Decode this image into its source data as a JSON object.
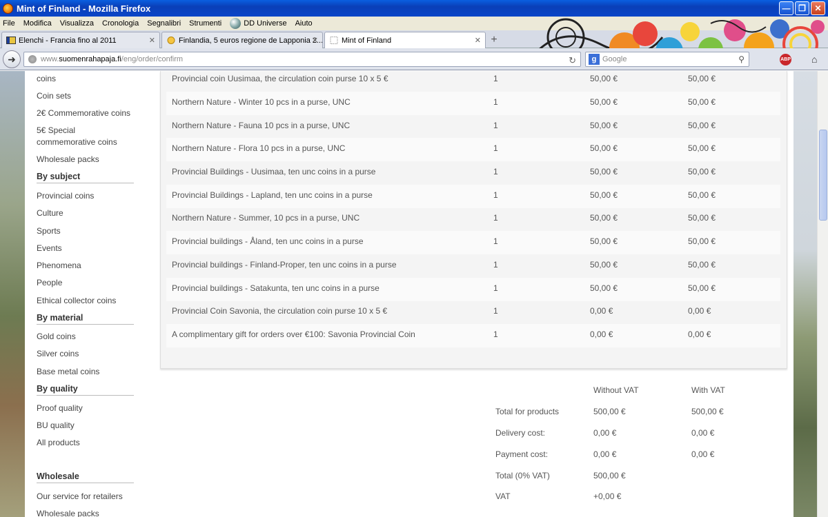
{
  "window": {
    "title": "Mint of Finland - Mozilla Firefox"
  },
  "menu": [
    "File",
    "Modifica",
    "Visualizza",
    "Cronologia",
    "Segnalibri",
    "Strumenti",
    "DD Universe",
    "Aiuto"
  ],
  "tabs": [
    {
      "label": "Elenchi - Francia fino al 2011"
    },
    {
      "label": "Finlandia, 5 euros regione de Lapponia 2..."
    },
    {
      "label": "Mint of Finland"
    }
  ],
  "url": {
    "prefix": "www.",
    "host": "suomenrahapaja.fi",
    "path": "/eng/order/confirm"
  },
  "search": {
    "placeholder": "Google"
  },
  "sidebar": {
    "top_links": [
      "coins",
      "Coin sets",
      "2€ Commemorative coins",
      "5€ Special commemorative coins",
      "Wholesale packs"
    ],
    "by_subject": {
      "heading": "By subject",
      "links": [
        "Provincial coins",
        "Culture",
        "Sports",
        "Events",
        "Phenomena",
        "People",
        "Ethical collector coins"
      ]
    },
    "by_material": {
      "heading": "By material",
      "links": [
        "Gold coins",
        "Silver coins",
        "Base metal coins"
      ]
    },
    "by_quality": {
      "heading": "By quality",
      "links": [
        "Proof quality",
        "BU quality",
        "All products"
      ]
    },
    "wholesale": {
      "heading": "Wholesale",
      "links": [
        "Our service for retailers",
        "Wholesale packs"
      ]
    }
  },
  "order_items": [
    {
      "name": "Provincial coin Uusimaa, the circulation coin purse 10 x 5 €",
      "qty": "1",
      "price": "50,00 €",
      "total": "50,00 €"
    },
    {
      "name": "Northern Nature - Winter 10 pcs in a purse, UNC",
      "qty": "1",
      "price": "50,00 €",
      "total": "50,00 €"
    },
    {
      "name": "Northern Nature - Fauna 10 pcs in a purse, UNC",
      "qty": "1",
      "price": "50,00 €",
      "total": "50,00 €"
    },
    {
      "name": "Northern Nature - Flora 10 pcs in a purse, UNC",
      "qty": "1",
      "price": "50,00 €",
      "total": "50,00 €"
    },
    {
      "name": "Provincial Buildings - Uusimaa, ten unc coins in a purse",
      "qty": "1",
      "price": "50,00 €",
      "total": "50,00 €"
    },
    {
      "name": "Provincial Buildings - Lapland, ten unc coins in a purse",
      "qty": "1",
      "price": "50,00 €",
      "total": "50,00 €"
    },
    {
      "name": "Northern Nature - Summer, 10 pcs in a purse, UNC",
      "qty": "1",
      "price": "50,00 €",
      "total": "50,00 €"
    },
    {
      "name": "Provincial buildings - Åland, ten unc coins in a purse",
      "qty": "1",
      "price": "50,00 €",
      "total": "50,00 €"
    },
    {
      "name": "Provincial buildings - Finland-Proper, ten unc coins in a purse",
      "qty": "1",
      "price": "50,00 €",
      "total": "50,00 €"
    },
    {
      "name": "Provincial buildings - Satakunta, ten unc coins in a purse",
      "qty": "1",
      "price": "50,00 €",
      "total": "50,00 €"
    },
    {
      "name": "Provincial Coin Savonia, the circulation coin purse 10 x 5 €",
      "qty": "1",
      "price": "0,00 €",
      "total": "0,00 €"
    },
    {
      "name": "A complimentary gift for orders over €100: Savonia Provincial Coin",
      "qty": "1",
      "price": "0,00 €",
      "total": "0,00 €"
    }
  ],
  "totals": {
    "col_without_vat": "Without VAT",
    "col_with_vat": "With VAT",
    "rows": [
      {
        "label": "Total for products",
        "without": "500,00 €",
        "with": "500,00 €"
      },
      {
        "label": "Delivery cost:",
        "without": "0,00 €",
        "with": "0,00 €"
      },
      {
        "label": "Payment cost:",
        "without": "0,00 €",
        "with": "0,00 €"
      },
      {
        "label": "Total (0% VAT)",
        "without": "500,00 €",
        "with": ""
      },
      {
        "label": "VAT",
        "without": "+0,00 €",
        "with": ""
      }
    ]
  }
}
